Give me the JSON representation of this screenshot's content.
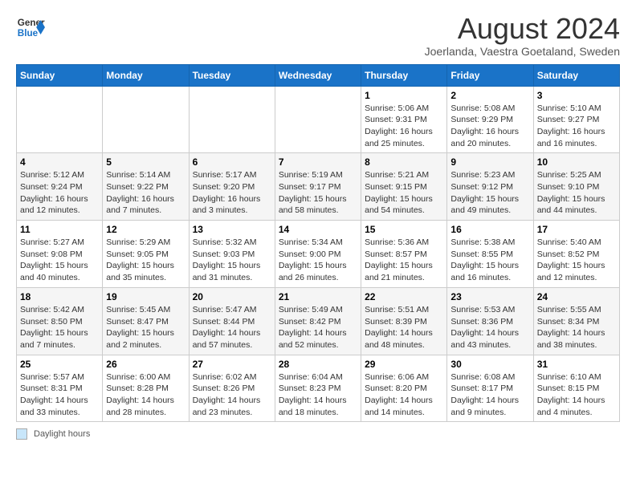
{
  "header": {
    "logo_line1": "General",
    "logo_line2": "Blue",
    "title": "August 2024",
    "subtitle": "Joerlanda, Vaestra Goetaland, Sweden"
  },
  "days_of_week": [
    "Sunday",
    "Monday",
    "Tuesday",
    "Wednesday",
    "Thursday",
    "Friday",
    "Saturday"
  ],
  "weeks": [
    [
      {
        "day": "",
        "info": ""
      },
      {
        "day": "",
        "info": ""
      },
      {
        "day": "",
        "info": ""
      },
      {
        "day": "",
        "info": ""
      },
      {
        "day": "1",
        "info": "Sunrise: 5:06 AM\nSunset: 9:31 PM\nDaylight: 16 hours\nand 25 minutes."
      },
      {
        "day": "2",
        "info": "Sunrise: 5:08 AM\nSunset: 9:29 PM\nDaylight: 16 hours\nand 20 minutes."
      },
      {
        "day": "3",
        "info": "Sunrise: 5:10 AM\nSunset: 9:27 PM\nDaylight: 16 hours\nand 16 minutes."
      }
    ],
    [
      {
        "day": "4",
        "info": "Sunrise: 5:12 AM\nSunset: 9:24 PM\nDaylight: 16 hours\nand 12 minutes."
      },
      {
        "day": "5",
        "info": "Sunrise: 5:14 AM\nSunset: 9:22 PM\nDaylight: 16 hours\nand 7 minutes."
      },
      {
        "day": "6",
        "info": "Sunrise: 5:17 AM\nSunset: 9:20 PM\nDaylight: 16 hours\nand 3 minutes."
      },
      {
        "day": "7",
        "info": "Sunrise: 5:19 AM\nSunset: 9:17 PM\nDaylight: 15 hours\nand 58 minutes."
      },
      {
        "day": "8",
        "info": "Sunrise: 5:21 AM\nSunset: 9:15 PM\nDaylight: 15 hours\nand 54 minutes."
      },
      {
        "day": "9",
        "info": "Sunrise: 5:23 AM\nSunset: 9:12 PM\nDaylight: 15 hours\nand 49 minutes."
      },
      {
        "day": "10",
        "info": "Sunrise: 5:25 AM\nSunset: 9:10 PM\nDaylight: 15 hours\nand 44 minutes."
      }
    ],
    [
      {
        "day": "11",
        "info": "Sunrise: 5:27 AM\nSunset: 9:08 PM\nDaylight: 15 hours\nand 40 minutes."
      },
      {
        "day": "12",
        "info": "Sunrise: 5:29 AM\nSunset: 9:05 PM\nDaylight: 15 hours\nand 35 minutes."
      },
      {
        "day": "13",
        "info": "Sunrise: 5:32 AM\nSunset: 9:03 PM\nDaylight: 15 hours\nand 31 minutes."
      },
      {
        "day": "14",
        "info": "Sunrise: 5:34 AM\nSunset: 9:00 PM\nDaylight: 15 hours\nand 26 minutes."
      },
      {
        "day": "15",
        "info": "Sunrise: 5:36 AM\nSunset: 8:57 PM\nDaylight: 15 hours\nand 21 minutes."
      },
      {
        "day": "16",
        "info": "Sunrise: 5:38 AM\nSunset: 8:55 PM\nDaylight: 15 hours\nand 16 minutes."
      },
      {
        "day": "17",
        "info": "Sunrise: 5:40 AM\nSunset: 8:52 PM\nDaylight: 15 hours\nand 12 minutes."
      }
    ],
    [
      {
        "day": "18",
        "info": "Sunrise: 5:42 AM\nSunset: 8:50 PM\nDaylight: 15 hours\nand 7 minutes."
      },
      {
        "day": "19",
        "info": "Sunrise: 5:45 AM\nSunset: 8:47 PM\nDaylight: 15 hours\nand 2 minutes."
      },
      {
        "day": "20",
        "info": "Sunrise: 5:47 AM\nSunset: 8:44 PM\nDaylight: 14 hours\nand 57 minutes."
      },
      {
        "day": "21",
        "info": "Sunrise: 5:49 AM\nSunset: 8:42 PM\nDaylight: 14 hours\nand 52 minutes."
      },
      {
        "day": "22",
        "info": "Sunrise: 5:51 AM\nSunset: 8:39 PM\nDaylight: 14 hours\nand 48 minutes."
      },
      {
        "day": "23",
        "info": "Sunrise: 5:53 AM\nSunset: 8:36 PM\nDaylight: 14 hours\nand 43 minutes."
      },
      {
        "day": "24",
        "info": "Sunrise: 5:55 AM\nSunset: 8:34 PM\nDaylight: 14 hours\nand 38 minutes."
      }
    ],
    [
      {
        "day": "25",
        "info": "Sunrise: 5:57 AM\nSunset: 8:31 PM\nDaylight: 14 hours\nand 33 minutes."
      },
      {
        "day": "26",
        "info": "Sunrise: 6:00 AM\nSunset: 8:28 PM\nDaylight: 14 hours\nand 28 minutes."
      },
      {
        "day": "27",
        "info": "Sunrise: 6:02 AM\nSunset: 8:26 PM\nDaylight: 14 hours\nand 23 minutes."
      },
      {
        "day": "28",
        "info": "Sunrise: 6:04 AM\nSunset: 8:23 PM\nDaylight: 14 hours\nand 18 minutes."
      },
      {
        "day": "29",
        "info": "Sunrise: 6:06 AM\nSunset: 8:20 PM\nDaylight: 14 hours\nand 14 minutes."
      },
      {
        "day": "30",
        "info": "Sunrise: 6:08 AM\nSunset: 8:17 PM\nDaylight: 14 hours\nand 9 minutes."
      },
      {
        "day": "31",
        "info": "Sunrise: 6:10 AM\nSunset: 8:15 PM\nDaylight: 14 hours\nand 4 minutes."
      }
    ]
  ],
  "legend": {
    "box_label": "Daylight hours"
  }
}
